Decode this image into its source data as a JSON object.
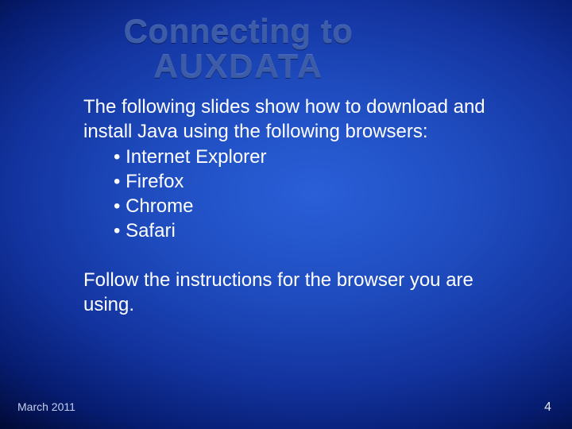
{
  "title": {
    "line1": "Connecting to",
    "line2": "AUXDATA"
  },
  "body": {
    "intro": "The following slides show how to download and install Java using the following browsers:",
    "bullets": [
      "Internet Explorer",
      "Firefox",
      "Chrome",
      "Safari"
    ],
    "follow": "Follow the instructions for the browser you are using."
  },
  "footer": {
    "date": "March 2011",
    "page": "4"
  }
}
